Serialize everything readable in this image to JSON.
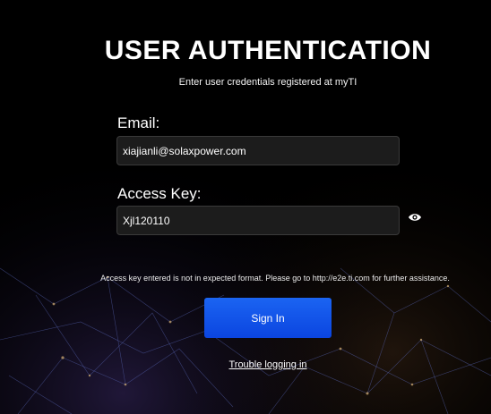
{
  "header": {
    "title": "USER AUTHENTICATION",
    "subtitle": "Enter user credentials registered at myTI"
  },
  "form": {
    "email_label": "Email:",
    "email_value": "xiajianli@solaxpower.com",
    "access_key_label": "Access Key:",
    "access_key_value": "Xjl120110",
    "show_key_icon": "eye-icon",
    "error_message": "Access key entered is not in expected format. Please go to http://e2e.ti.com for further assistance.",
    "sign_in_label": "Sign In",
    "trouble_link": "Trouble logging in"
  },
  "colors": {
    "background": "#000000",
    "button": "#1b5cf0",
    "field_background": "#1c1c1c"
  }
}
